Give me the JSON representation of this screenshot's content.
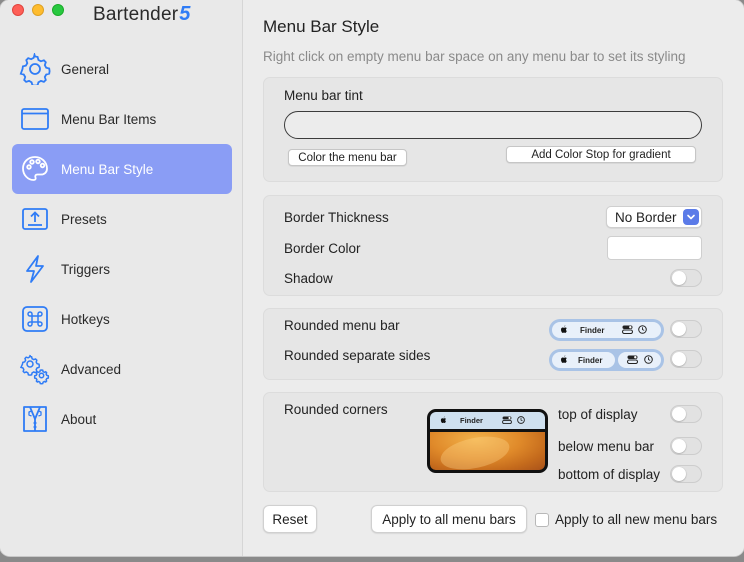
{
  "app": {
    "name": "Bartender",
    "version_mark": "5"
  },
  "sidebar": {
    "items": [
      {
        "label": "General",
        "icon": "gear-icon"
      },
      {
        "label": "Menu Bar Items",
        "icon": "window-icon"
      },
      {
        "label": "Menu Bar Style",
        "icon": "palette-icon"
      },
      {
        "label": "Presets",
        "icon": "upload-icon"
      },
      {
        "label": "Triggers",
        "icon": "bolt-icon"
      },
      {
        "label": "Hotkeys",
        "icon": "command-key-icon"
      },
      {
        "label": "Advanced",
        "icon": "gears-icon"
      },
      {
        "label": "About",
        "icon": "tuxedo-icon"
      }
    ],
    "active_index": 2
  },
  "main": {
    "title": "Menu Bar Style",
    "subtitle": "Right click on empty menu bar space on any menu bar to set its styling",
    "tint": {
      "label": "Menu bar tint",
      "color_button": "Color the menu bar",
      "gradient_button": "Add Color Stop for gradient"
    },
    "border": {
      "thickness_label": "Border Thickness",
      "thickness_value": "No Border",
      "color_label": "Border Color",
      "shadow_label": "Shadow",
      "shadow_on": false
    },
    "rounding": {
      "menu_bar_label": "Rounded menu bar",
      "separate_sides_label": "Rounded separate sides",
      "menu_bar_on": false,
      "separate_sides_on": false,
      "preview_finder": "Finder"
    },
    "corners": {
      "label": "Rounded corners",
      "preview_finder": "Finder",
      "options": [
        {
          "label": "top of display",
          "on": false
        },
        {
          "label": "below menu bar",
          "on": false
        },
        {
          "label": "bottom of display",
          "on": false
        }
      ]
    },
    "footer": {
      "reset": "Reset",
      "apply_all": "Apply to all menu bars",
      "apply_new_label": "Apply to all new menu bars",
      "apply_new_checked": false
    }
  },
  "colors": {
    "accent": "#8a9df5",
    "brand_blue": "#2f7cf6",
    "select_chevron": "#5b7be8"
  }
}
